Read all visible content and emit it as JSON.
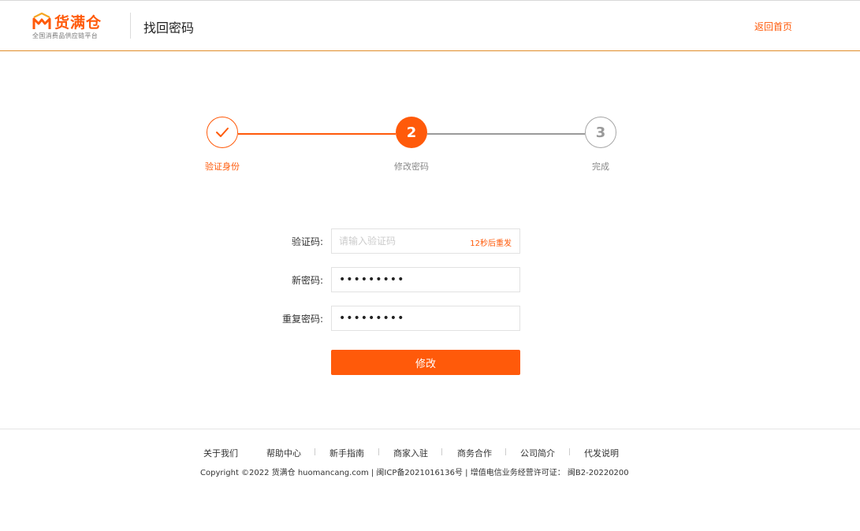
{
  "header": {
    "logo_name": "货满仓",
    "logo_tagline": "全国消费品供应链平台",
    "page_title": "找回密码",
    "home_link": "返回首页"
  },
  "steps": [
    {
      "number": "",
      "label": "验证身份",
      "status": "done"
    },
    {
      "number": "2",
      "label": "修改密码",
      "status": "active"
    },
    {
      "number": "3",
      "label": "完成",
      "status": "pending"
    }
  ],
  "form": {
    "code_label": "验证码:",
    "code_placeholder": "请输入验证码",
    "code_value": "",
    "resend_text": "12秒后重发",
    "new_password_label": "新密码:",
    "new_password_value": "•••••••••",
    "repeat_password_label": "重复密码:",
    "repeat_password_value": "•••••••••",
    "submit_label": "修改"
  },
  "footer": {
    "links": [
      "关于我们",
      "帮助中心",
      "新手指南",
      "商家入驻",
      "商务合作",
      "公司简介",
      "代发说明"
    ],
    "copyright": "Copyright ©2022 货满仓 huomancang.com | 闽ICP备2021016136号 | 增值电信业务经营许可证： 闽B2-20220200"
  },
  "colors": {
    "accent": "#ff5a0a",
    "header_border": "#e08c2a",
    "pending": "#9a9a9a"
  }
}
